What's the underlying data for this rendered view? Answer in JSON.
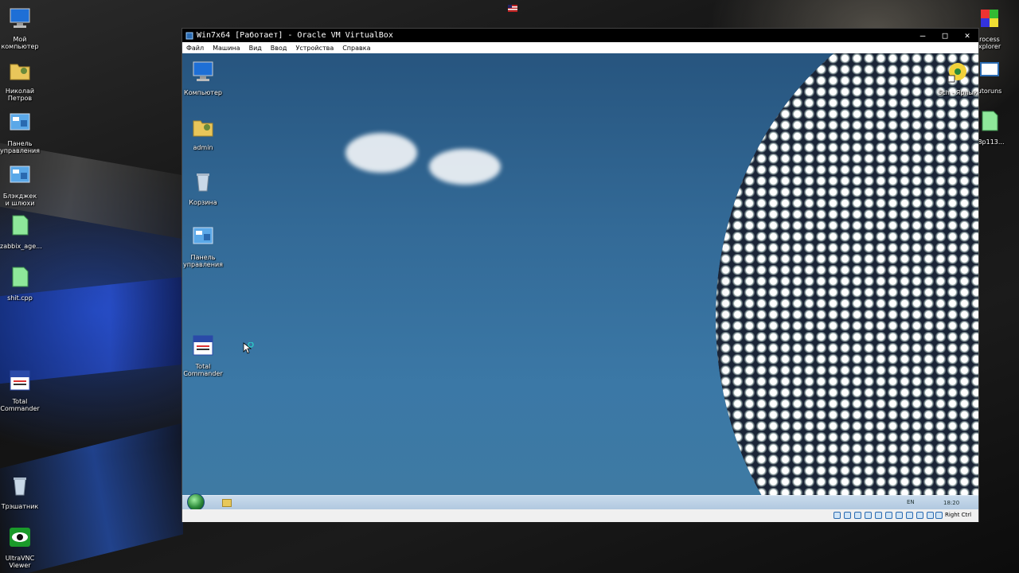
{
  "host_desktop": {
    "icons_left": [
      {
        "label": "Мой компьютер",
        "icon": "computer-icon"
      },
      {
        "label": "Николай Петров",
        "icon": "user-folder-icon"
      },
      {
        "label": "Панель управления",
        "icon": "control-panel-icon"
      },
      {
        "label": "Блэкджек и шлюхи",
        "icon": "control-panel-icon"
      },
      {
        "label": "zabbix_age...",
        "icon": "document-icon"
      },
      {
        "label": "shit.cpp",
        "icon": "document-icon"
      },
      {
        "label": "Total Commander",
        "icon": "total-commander-icon"
      },
      {
        "label": "Трэшатник",
        "icon": "recycle-bin-icon"
      },
      {
        "label": "UltraVNC Viewer",
        "icon": "ultravnc-icon"
      }
    ],
    "icons_right": [
      {
        "label": "rocess xplorer",
        "icon": "process-explorer-icon"
      },
      {
        "label": "utoruns",
        "icon": "autoruns-icon"
      },
      {
        "label": "_8p113...",
        "icon": "document-icon"
      }
    ]
  },
  "vm_window": {
    "title": "Win7x64 [Работает] - Oracle VM VirtualBox",
    "menu": [
      "Файл",
      "Машина",
      "Вид",
      "Ввод",
      "Устройства",
      "Справка"
    ],
    "host_key": "Right Ctrl"
  },
  "guest": {
    "icons": [
      {
        "label": "Компьютер",
        "icon": "computer-icon"
      },
      {
        "label": "admin",
        "icon": "user-folder-icon"
      },
      {
        "label": "Корзина",
        "icon": "recycle-bin-icon"
      },
      {
        "label": "Панель управления",
        "icon": "control-panel-icon"
      },
      {
        "label": "Total Commander",
        "icon": "total-commander-icon"
      },
      {
        "label": "Sch - Ярлык",
        "icon": "shortcut-icon"
      }
    ],
    "taskbar": {
      "lang": "EN",
      "clock": "18:20"
    }
  },
  "colors": {
    "vm_title_bg": "#000000",
    "taskbar": "#c9dbec",
    "sky": "#336a97"
  }
}
